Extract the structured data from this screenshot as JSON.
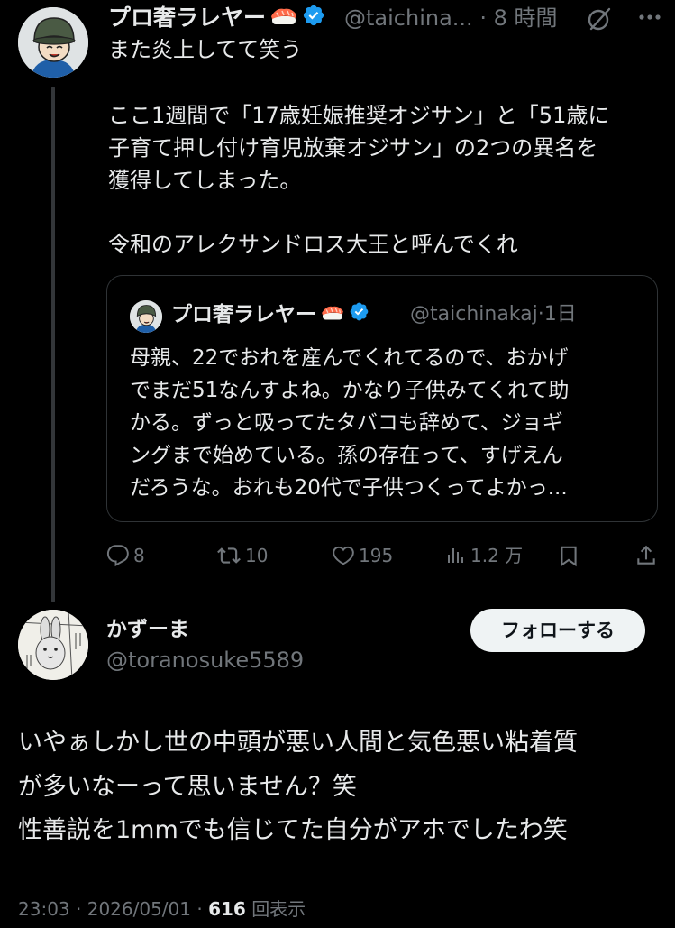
{
  "tweet": {
    "author_name": "プロ奢ラレヤー",
    "handle": "@taichina...",
    "separator": "·",
    "time": "8 時間",
    "lines": [
      "また炎上してて笑う",
      "",
      "ここ1週間で「17歳妊娠推奨オジサン」と「51歳に",
      "子育て押し付け育児放棄オジサン」の2つの異名を",
      "獲得してしまった。",
      "",
      "令和のアレクサンドロス大王と呼んでくれ"
    ],
    "quote": {
      "author_name": "プロ奢ラレヤー",
      "handle": "@taichinakaj",
      "separator": "·",
      "time": "1日",
      "lines": [
        "母親、22でおれを産んでくれてるので、おかげ",
        "でまだ51なんすよね。かなり子供みてくれて助",
        "かる。ずっと吸ってたタバコも辞めて、ジョギ",
        "ングまで始めている。孫の存在って、すげえん",
        "だろうな。おれも20代で子供つくってよかっ..."
      ]
    },
    "actions": {
      "replies": "8",
      "retweets": "10",
      "likes": "195",
      "views": "1.2 万"
    }
  },
  "reply": {
    "author_name": "かずーま",
    "handle": "@toranosuke5589",
    "follow_label": "フォローする",
    "lines": [
      "いやぁしかし世の中頭が悪い人間と気色悪い粘着質",
      "が多いなーって思いません？笑",
      "性善説を1mmでも信じてた自分がアホでしたわ笑"
    ],
    "time": "23:03",
    "date": "2026/05/01",
    "separator": "·",
    "view_count": "616",
    "view_label": "回表示"
  },
  "icons": {
    "sushi": "sushi-emoji-icon",
    "verified": "verified-badge-icon",
    "grok": "grok-icon",
    "more": "more-icon",
    "reply": "reply-icon",
    "retweet": "retweet-icon",
    "like": "heart-icon",
    "views": "views-icon",
    "bookmark": "bookmark-icon",
    "share": "share-icon"
  },
  "colors": {
    "background": "#000000",
    "text_primary": "#e7e9ea",
    "text_secondary": "#71767b",
    "verified_blue": "#1d9bf0",
    "follow_button_bg": "#eff3f4"
  }
}
